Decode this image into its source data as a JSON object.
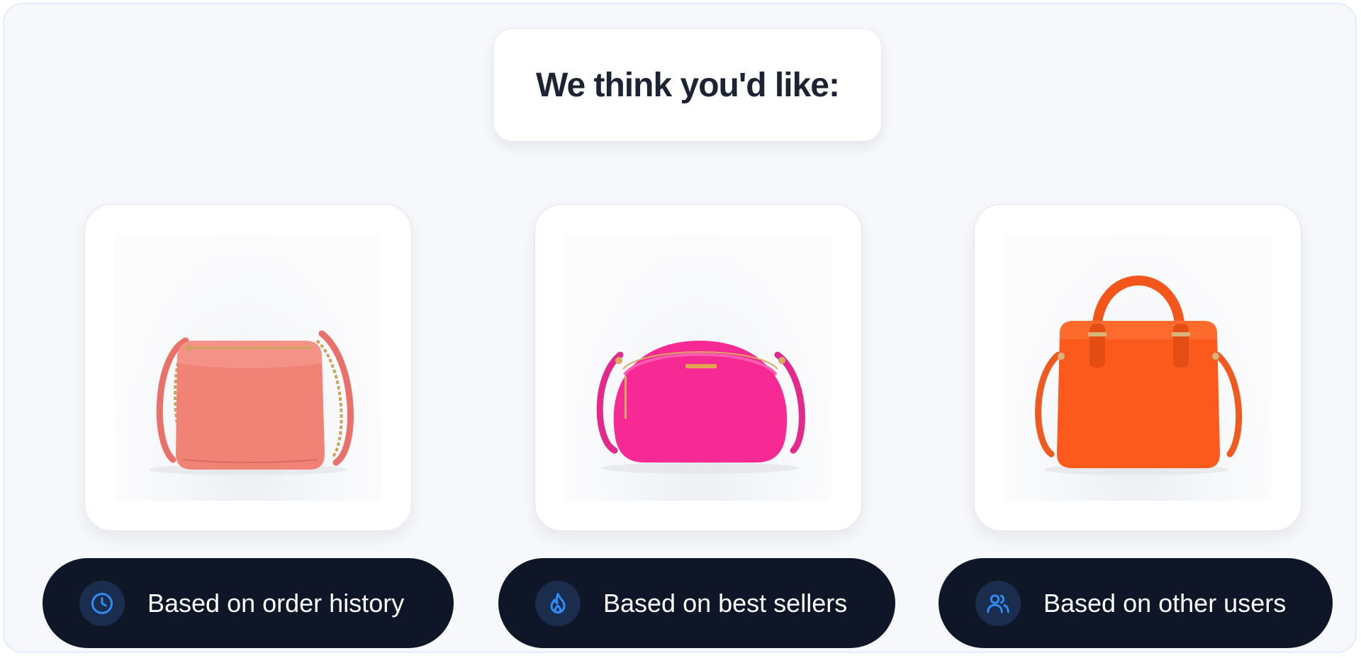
{
  "header": {
    "title": "We think you'd like:"
  },
  "products": [
    {
      "image_name": "coral-leather-shoulder-bag-with-chain-strap",
      "bag_color": "#f08276",
      "reason_label": "Based on order history",
      "reason_icon": "clock-icon"
    },
    {
      "image_name": "hot-pink-dome-crossbody-bag",
      "bag_color": "#f72a95",
      "reason_label": "Based on best sellers",
      "reason_icon": "flame-icon"
    },
    {
      "image_name": "orange-top-handle-tote-bag",
      "bag_color": "#fb5a1c",
      "reason_label": "Based on other users",
      "reason_icon": "users-icon"
    }
  ],
  "colors": {
    "background": "#f7f8fb",
    "pill_background": "#0e1628",
    "icon_accent": "#2f8cf7"
  }
}
